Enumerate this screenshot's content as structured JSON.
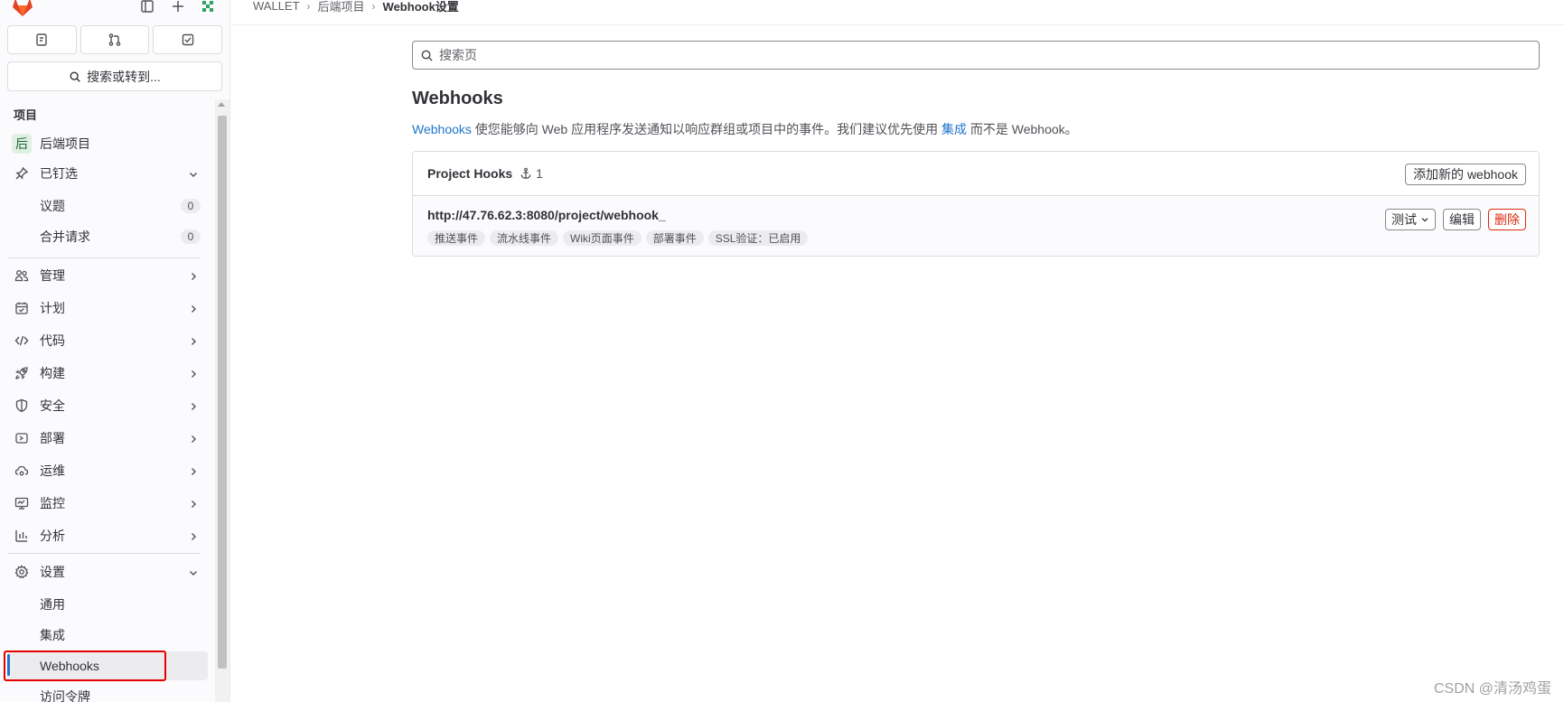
{
  "colors": {
    "accent": "#1f75cb",
    "danger": "#dd2b0e",
    "highlight": "#e60000"
  },
  "sidebar": {
    "search_label": "搜索或转到...",
    "section_label": "项目",
    "project": {
      "avatar_letter": "后",
      "name": "后端项目"
    },
    "pinned": {
      "label": "已钉选",
      "items": [
        {
          "label": "议题",
          "count": "0"
        },
        {
          "label": "合并请求",
          "count": "0"
        }
      ]
    },
    "groups": [
      {
        "label": "管理",
        "icon": "users-icon"
      },
      {
        "label": "计划",
        "icon": "calendar-icon"
      },
      {
        "label": "代码",
        "icon": "code-icon"
      },
      {
        "label": "构建",
        "icon": "rocket-icon"
      },
      {
        "label": "安全",
        "icon": "shield-icon"
      },
      {
        "label": "部署",
        "icon": "deploy-icon"
      },
      {
        "label": "运维",
        "icon": "cloud-gear-icon"
      },
      {
        "label": "监控",
        "icon": "monitor-icon"
      },
      {
        "label": "分析",
        "icon": "chart-icon"
      }
    ],
    "settings": {
      "label": "设置",
      "items": [
        {
          "label": "通用"
        },
        {
          "label": "集成"
        },
        {
          "label": "Webhooks"
        },
        {
          "label": "访问令牌"
        }
      ]
    }
  },
  "breadcrumb": [
    "WALLET",
    "后端项目",
    "Webhook设置"
  ],
  "search": {
    "placeholder": "搜索页"
  },
  "page": {
    "title": "Webhooks",
    "desc_link": "Webhooks",
    "desc_text_1": " 使您能够向 Web 应用程序发送通知以响应群组或项目中的事件。我们建议优先使用 ",
    "desc_link_2": "集成",
    "desc_text_2": " 而不是 Webhook。"
  },
  "hooks": {
    "title": "Project Hooks",
    "count": "1",
    "add_label": "添加新的 webhook",
    "items": [
      {
        "url": "http://47.76.62.3:8080/project/webhook_",
        "tags": [
          "推送事件",
          "流水线事件",
          "Wiki页面事件",
          "部署事件",
          "SSL验证：已启用"
        ],
        "test_label": "测试",
        "edit_label": "编辑",
        "delete_label": "删除"
      }
    ]
  },
  "watermark": "CSDN @清汤鸡蛋"
}
